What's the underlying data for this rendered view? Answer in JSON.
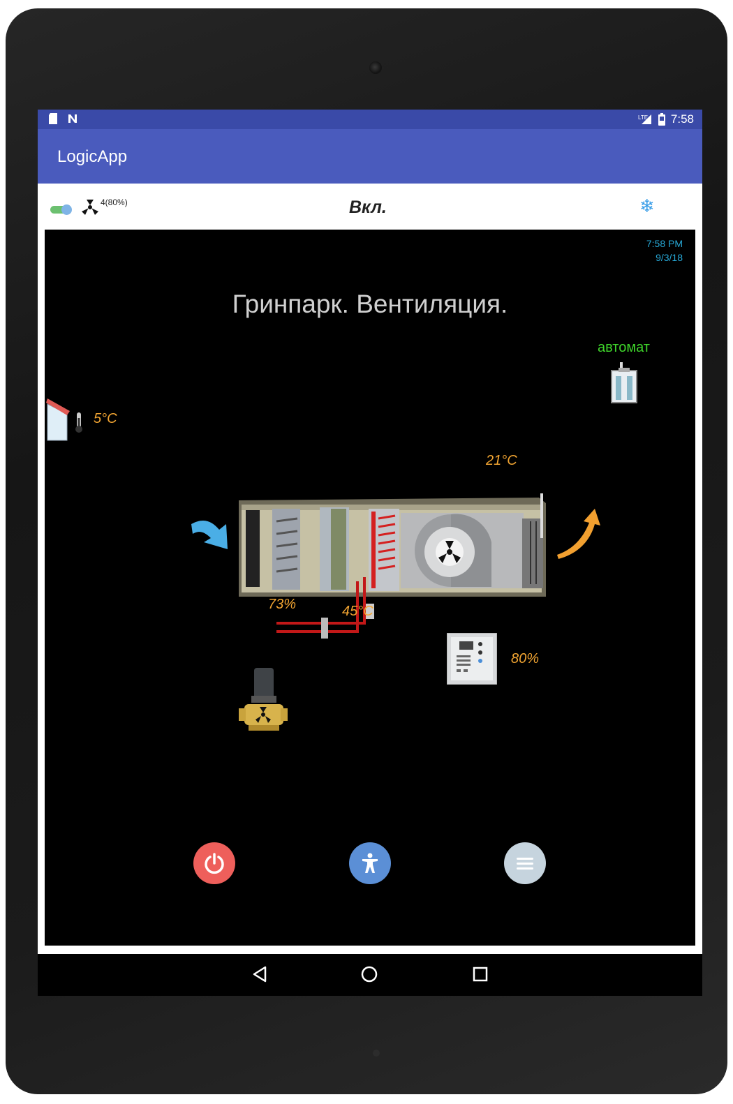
{
  "status_bar": {
    "time": "7:58"
  },
  "app_bar": {
    "title": "LogicApp"
  },
  "toolbar": {
    "fan_speed": "4(80%)",
    "system_state": "Вкл.",
    "mode_icon": "snowflake-icon"
  },
  "panel": {
    "clock_time": "7:58 PM",
    "clock_date": "9/3/18",
    "title": "Гринпарк. Вентиляция.",
    "mode": "автомат",
    "outside_temp": "5°C",
    "supply_temp": "21°C",
    "valve_open": "73%",
    "water_temp": "45°C",
    "fan_output": "80%"
  },
  "buttons": {
    "power": "power-icon",
    "accessibility": "accessibility-icon",
    "menu": "menu-icon"
  },
  "colors": {
    "status_bar": "#3a4aa8",
    "app_bar": "#4a5bbd",
    "value_text": "#f2a532",
    "auto_text": "#3fd52b",
    "clock_text": "#27a8d6",
    "power_button": "#ee5f5b",
    "access_button": "#5b8fd6",
    "menu_button": "#c6d4de"
  }
}
